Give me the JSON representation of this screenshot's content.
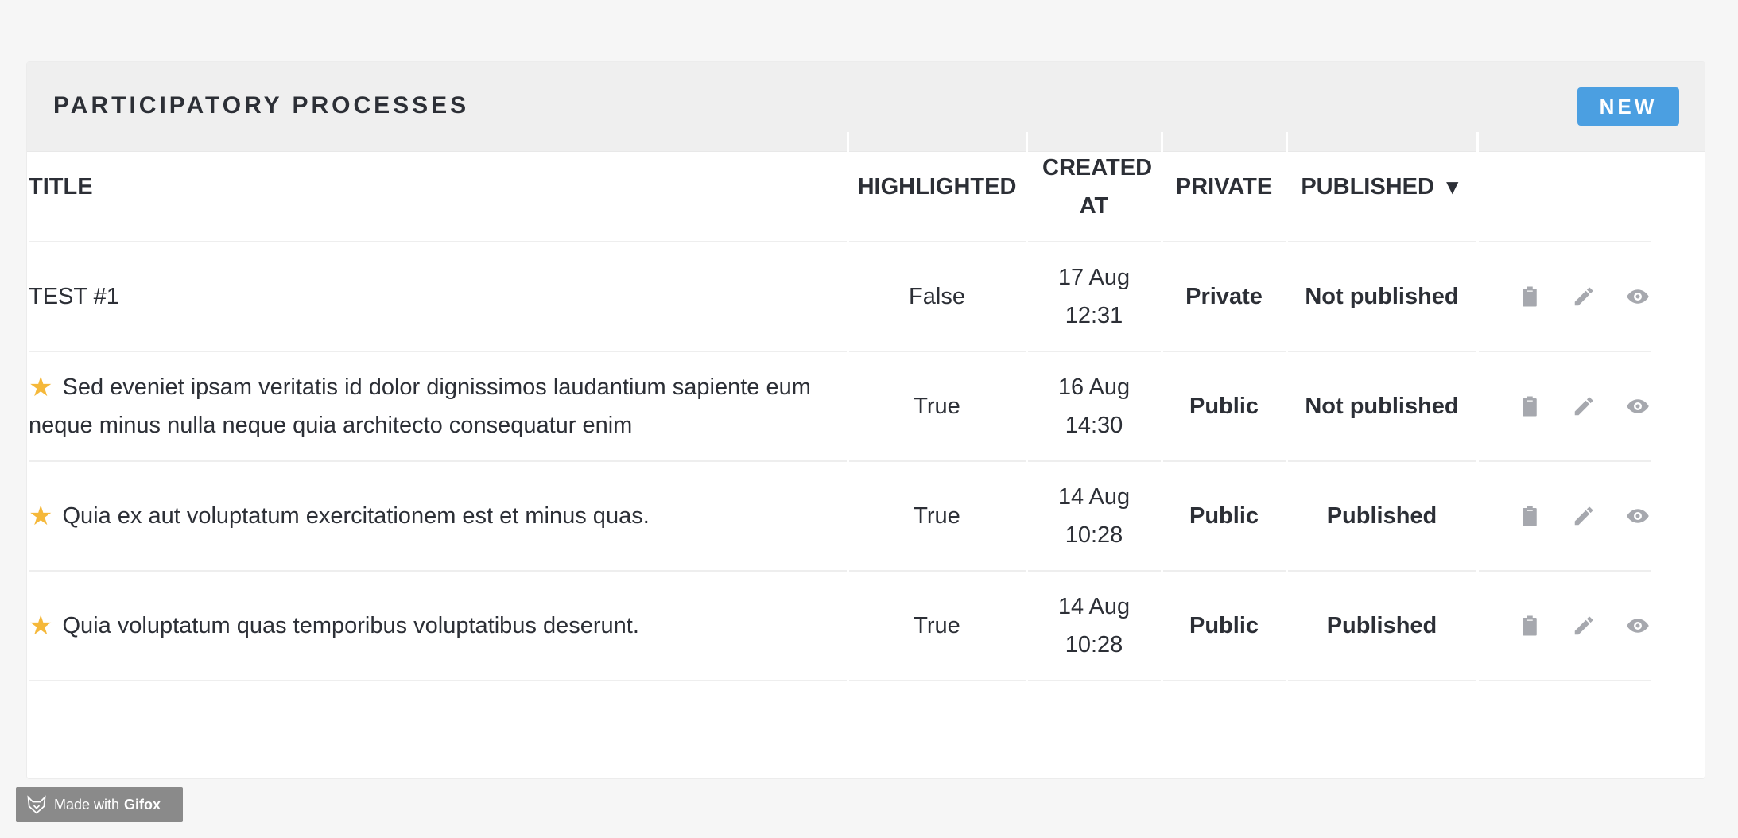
{
  "header": {
    "title": "PARTICIPATORY PROCESSES",
    "new_button": "NEW"
  },
  "table": {
    "columns": {
      "title": "TITLE",
      "highlighted": "HIGHLIGHTED",
      "created_at": "CREATED AT",
      "private": "PRIVATE",
      "published": "PUBLISHED",
      "published_sort_indicator": "▼"
    },
    "rows": [
      {
        "starred": false,
        "title": "TEST #1",
        "highlighted": "False",
        "created_date": "17 Aug",
        "created_time": "12:31",
        "private": "Private",
        "private_status": "red",
        "published": "Not published",
        "published_status": "red"
      },
      {
        "starred": true,
        "title": "Sed eveniet ipsam veritatis id dolor dignissimos laudantium sapiente eum neque minus nulla neque quia architecto consequatur enim",
        "highlighted": "True",
        "created_date": "16 Aug",
        "created_time": "14:30",
        "private": "Public",
        "private_status": "green",
        "published": "Not published",
        "published_status": "red"
      },
      {
        "starred": true,
        "title": "Quia ex aut voluptatum exercitationem est et minus quas.",
        "highlighted": "True",
        "created_date": "14 Aug",
        "created_time": "10:28",
        "private": "Public",
        "private_status": "green",
        "published": "Published",
        "published_status": "green"
      },
      {
        "starred": true,
        "title": "Quia voluptatum quas temporibus voluptatibus deserunt.",
        "highlighted": "True",
        "created_date": "14 Aug",
        "created_time": "10:28",
        "private": "Public",
        "private_status": "green",
        "published": "Published",
        "published_status": "green"
      }
    ],
    "row_actions": [
      "clipboard-icon",
      "pencil-icon",
      "eye-icon"
    ]
  },
  "badge": {
    "prefix": "Made with",
    "brand": "Gifox"
  },
  "colors": {
    "accent": "#4b9fe1",
    "status_red": "#dc7b70",
    "status_green": "#7dc470",
    "star": "#f5b83a",
    "icon_gray": "#a6a8ae"
  }
}
